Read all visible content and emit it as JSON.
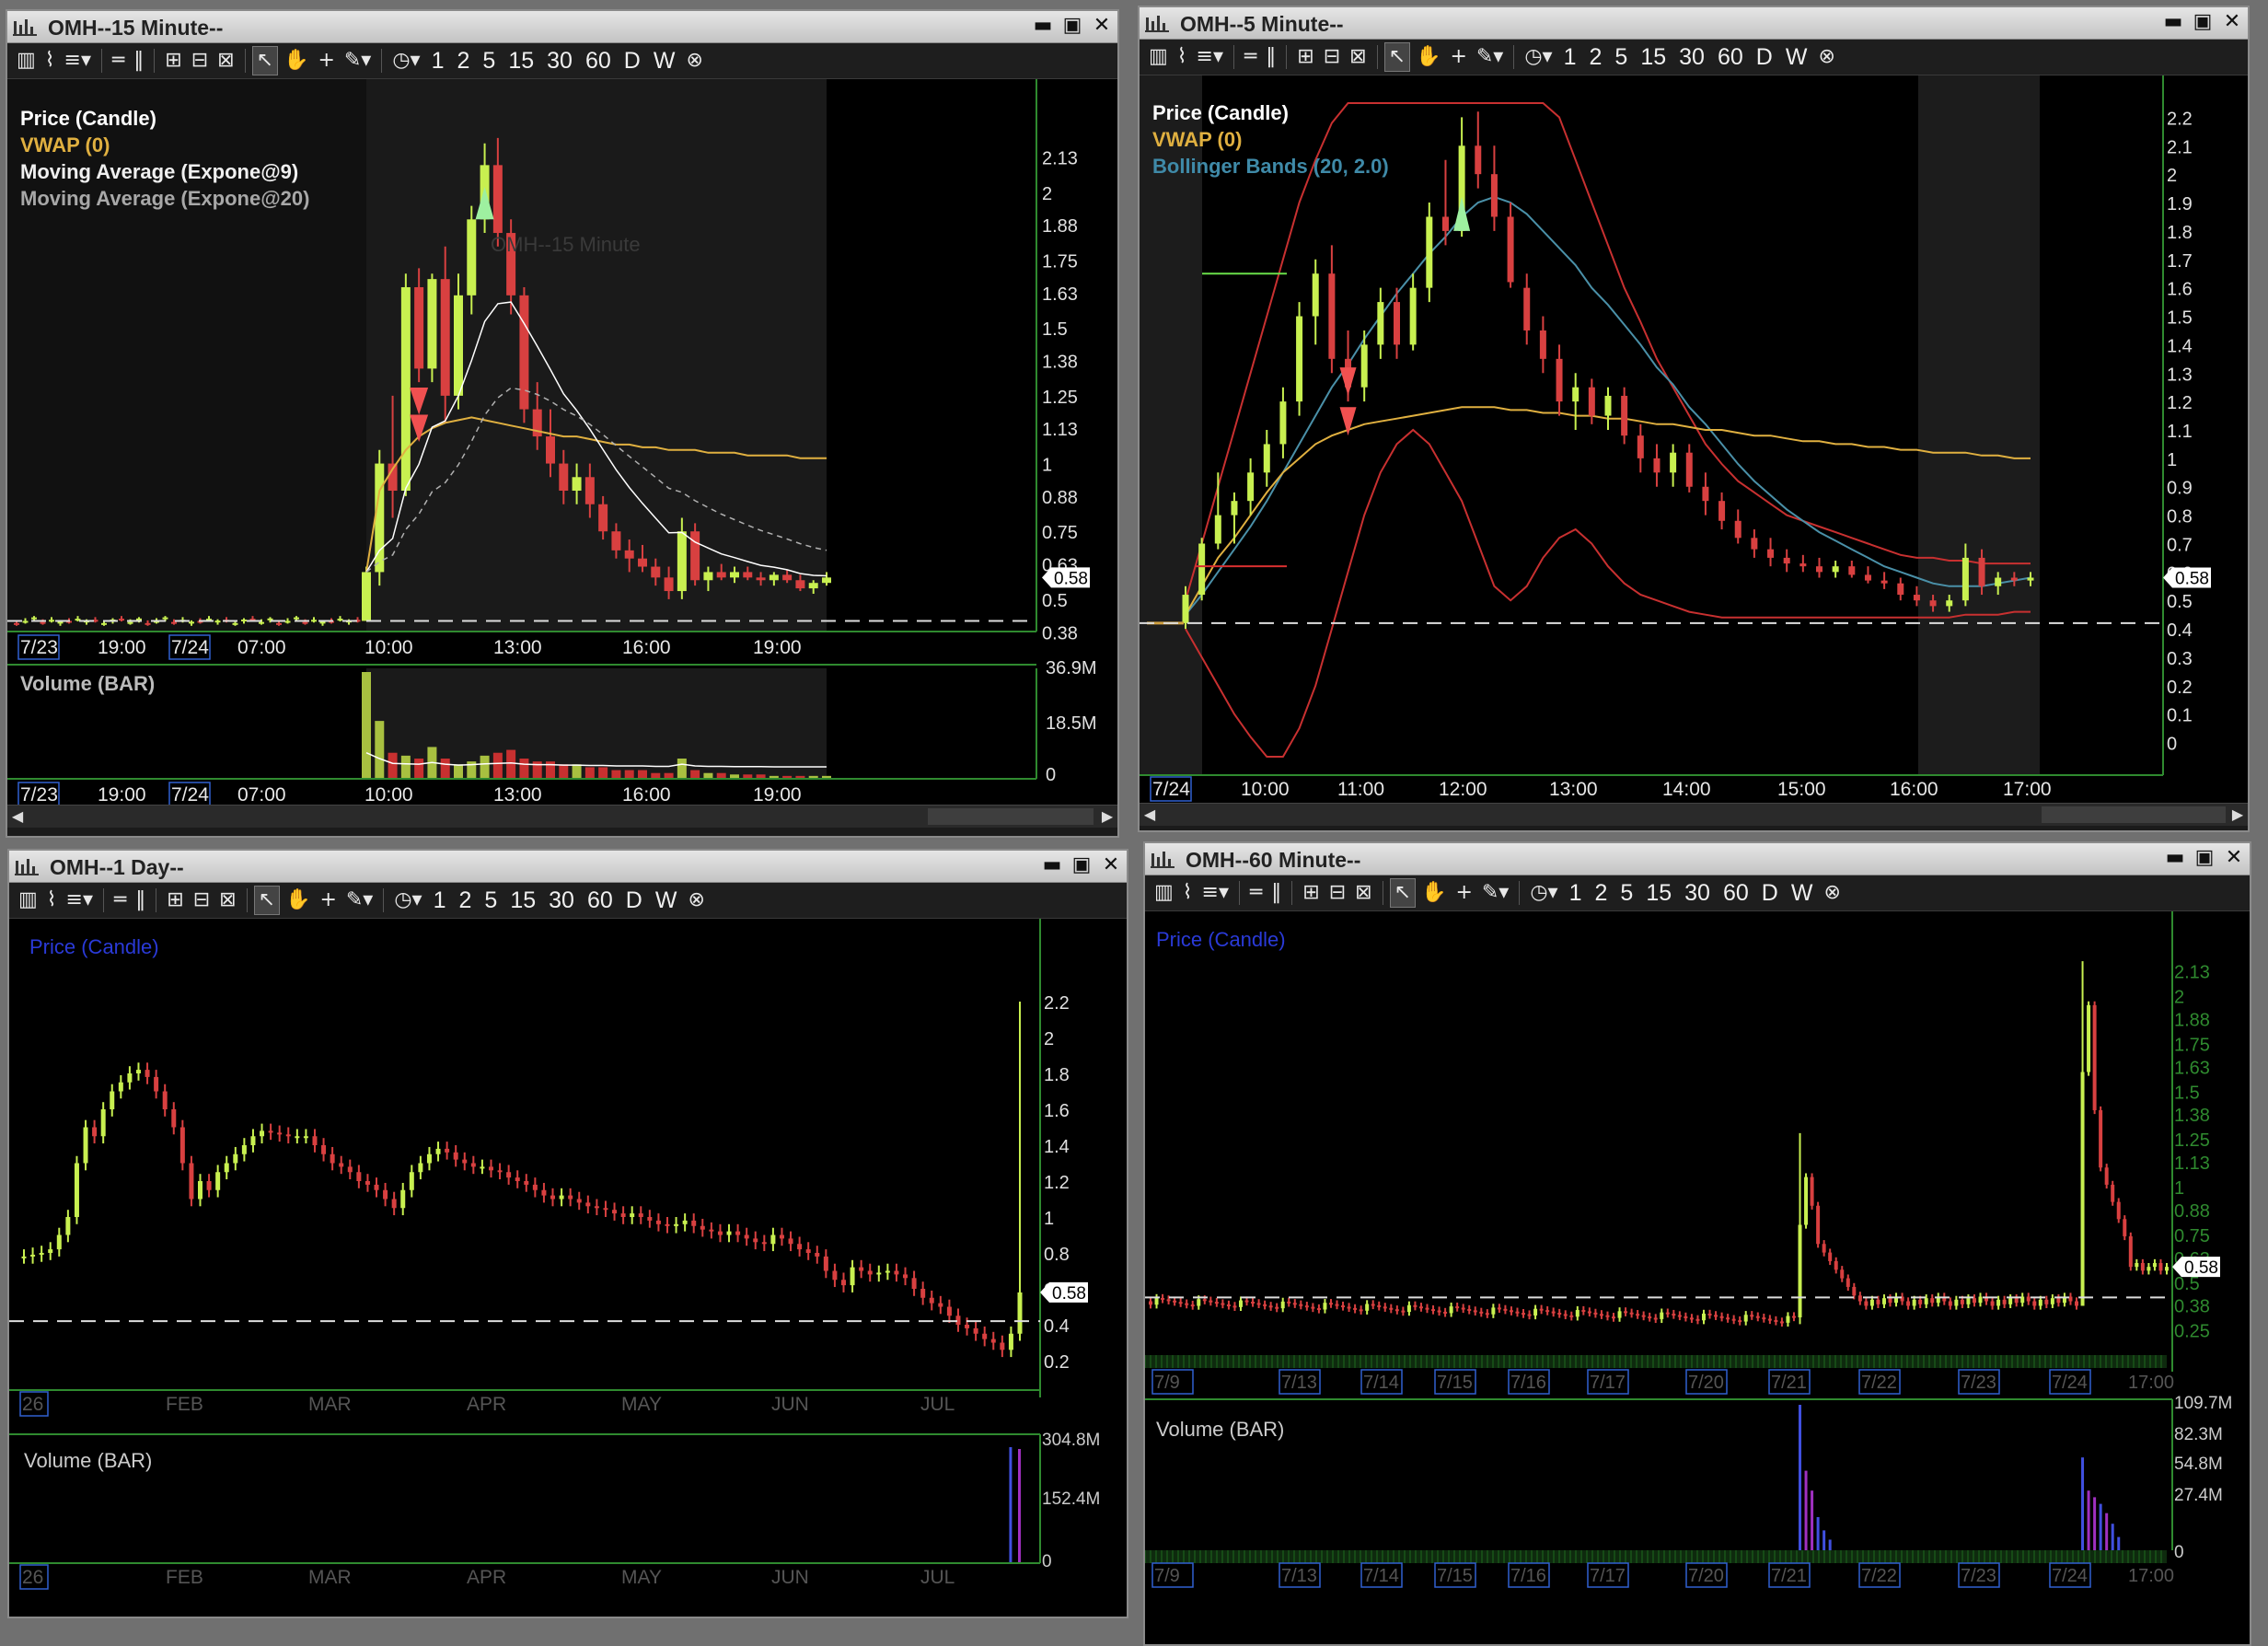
{
  "windows": {
    "w15": {
      "title": "OMH--15 Minute--"
    },
    "w5": {
      "title": "OMH--5 Minute--"
    },
    "wd": {
      "title": "OMH--1 Day--"
    },
    "w60": {
      "title": "OMH--60 Minute--"
    }
  },
  "toolbar": {
    "intervals": [
      "1",
      "2",
      "5",
      "15",
      "30",
      "60",
      "D",
      "W"
    ],
    "icons": [
      "bar-chart-icon",
      "line-style-icon",
      "studies-icon",
      "equal-icon",
      "pause-icon",
      "zoom-in-icon",
      "zoom-out-icon",
      "zoom-fit-icon",
      "pointer-icon",
      "hand-icon",
      "crosshair-icon",
      "pencil-icon",
      "clock-icon",
      "cancel-icon"
    ]
  },
  "colors": {
    "up": "#c8f050",
    "down": "#d84040",
    "vwap": "#e0b040",
    "ema9": "#ffffff",
    "ema20": "#b0b0b0",
    "bb": "#c83030",
    "bbmid": "#4a90a8",
    "axis": "#2f8a2f"
  },
  "chart_data": [
    {
      "type": "candlestick",
      "window": "OMH--15 Minute--",
      "watermark": "OMH--15 Minute",
      "legend": [
        "Price (Candle)",
        "VWAP (0)",
        "Moving Average (Expone@9)",
        "Moving Average (Expone@20)"
      ],
      "y_ticks": [
        "2.13",
        "2",
        "1.88",
        "1.75",
        "1.63",
        "1.5",
        "1.38",
        "1.25",
        "1.13",
        "1",
        "0.88",
        "0.75",
        "0.63",
        "0.5",
        "0.38"
      ],
      "ylim": [
        0.33,
        2.22
      ],
      "x_labels": [
        "7/23",
        "19:00",
        "7/24",
        "07:00",
        "10:00",
        "13:00",
        "16:00",
        "19:00"
      ],
      "last_price": "0.58",
      "reference_line": 0.42,
      "candles_premarket": 40,
      "candles": [
        [
          0.42,
          0.62,
          0.42,
          0.6
        ],
        [
          0.6,
          1.05,
          0.55,
          1.0
        ],
        [
          1.0,
          1.25,
          0.8,
          0.9
        ],
        [
          0.9,
          1.7,
          0.88,
          1.65
        ],
        [
          1.65,
          1.72,
          1.3,
          1.35
        ],
        [
          1.35,
          1.7,
          1.3,
          1.68
        ],
        [
          1.68,
          1.8,
          1.15,
          1.25
        ],
        [
          1.25,
          1.7,
          1.2,
          1.62
        ],
        [
          1.62,
          1.95,
          1.55,
          1.9
        ],
        [
          1.9,
          2.18,
          1.85,
          2.1
        ],
        [
          2.1,
          2.2,
          1.8,
          1.85
        ],
        [
          1.85,
          1.9,
          1.55,
          1.62
        ],
        [
          1.62,
          1.65,
          1.15,
          1.2
        ],
        [
          1.2,
          1.3,
          1.05,
          1.1
        ],
        [
          1.1,
          1.2,
          0.95,
          1.0
        ],
        [
          1.0,
          1.05,
          0.85,
          0.9
        ],
        [
          0.9,
          1.0,
          0.85,
          0.95
        ],
        [
          0.95,
          1.0,
          0.8,
          0.85
        ],
        [
          0.85,
          0.88,
          0.72,
          0.75
        ],
        [
          0.75,
          0.78,
          0.65,
          0.68
        ],
        [
          0.68,
          0.72,
          0.6,
          0.65
        ],
        [
          0.65,
          0.7,
          0.6,
          0.62
        ],
        [
          0.62,
          0.65,
          0.55,
          0.58
        ],
        [
          0.58,
          0.62,
          0.5,
          0.53
        ],
        [
          0.53,
          0.8,
          0.5,
          0.75
        ],
        [
          0.75,
          0.78,
          0.55,
          0.57
        ],
        [
          0.57,
          0.62,
          0.53,
          0.6
        ],
        [
          0.6,
          0.63,
          0.57,
          0.58
        ],
        [
          0.58,
          0.62,
          0.56,
          0.6
        ],
        [
          0.6,
          0.62,
          0.57,
          0.58
        ],
        [
          0.58,
          0.6,
          0.55,
          0.57
        ],
        [
          0.57,
          0.6,
          0.55,
          0.59
        ],
        [
          0.59,
          0.61,
          0.56,
          0.57
        ],
        [
          0.57,
          0.59,
          0.53,
          0.54
        ],
        [
          0.54,
          0.57,
          0.52,
          0.56
        ],
        [
          0.56,
          0.6,
          0.55,
          0.58
        ]
      ],
      "vwap": [
        0.6,
        0.9,
        0.98,
        1.05,
        1.1,
        1.13,
        1.15,
        1.16,
        1.17,
        1.16,
        1.15,
        1.14,
        1.13,
        1.12,
        1.11,
        1.1,
        1.1,
        1.09,
        1.08,
        1.07,
        1.07,
        1.06,
        1.06,
        1.05,
        1.05,
        1.05,
        1.04,
        1.04,
        1.04,
        1.03,
        1.03,
        1.03,
        1.03,
        1.02,
        1.02,
        1.02
      ],
      "volume": {
        "label": "Volume (BAR)",
        "y_ticks": [
          "36.9M",
          "18.5M",
          "0"
        ],
        "max": 36.9,
        "values": [
          36.9,
          20,
          9,
          8,
          7,
          11,
          7,
          5,
          6,
          8,
          9,
          10,
          7,
          6,
          6,
          5,
          5,
          4,
          4,
          3,
          3,
          3,
          2,
          2,
          7,
          3,
          2,
          2,
          1.5,
          1.5,
          1.5,
          1,
          1,
          1,
          1,
          1
        ]
      }
    },
    {
      "type": "candlestick",
      "window": "OMH--5 Minute--",
      "legend": [
        "Price (Candle)",
        "VWAP (0)",
        "Bollinger Bands (20, 2.0)"
      ],
      "y_ticks": [
        "2.2",
        "2.1",
        "2",
        "1.9",
        "1.8",
        "1.7",
        "1.6",
        "1.5",
        "1.4",
        "1.3",
        "1.2",
        "1.1",
        "1",
        "0.9",
        "0.8",
        "0.7",
        "0.6",
        "0.5",
        "0.4",
        "0.3",
        "0.2",
        "0.1",
        "0"
      ],
      "ylim": [
        -0.05,
        2.25
      ],
      "x_labels": [
        "7/24",
        "10:00",
        "11:00",
        "12:00",
        "13:00",
        "14:00",
        "15:00",
        "16:00",
        "17:00"
      ],
      "last_price": "0.58",
      "reference_line": 0.42,
      "candles": [
        [
          0.42,
          0.55,
          0.4,
          0.52
        ],
        [
          0.52,
          0.72,
          0.5,
          0.7
        ],
        [
          0.7,
          0.95,
          0.68,
          0.8
        ],
        [
          0.8,
          0.88,
          0.7,
          0.85
        ],
        [
          0.85,
          1.0,
          0.8,
          0.95
        ],
        [
          0.95,
          1.1,
          0.9,
          1.05
        ],
        [
          1.05,
          1.25,
          1.0,
          1.2
        ],
        [
          1.2,
          1.55,
          1.15,
          1.5
        ],
        [
          1.5,
          1.7,
          1.4,
          1.65
        ],
        [
          1.65,
          1.75,
          1.3,
          1.35
        ],
        [
          1.35,
          1.45,
          1.2,
          1.25
        ],
        [
          1.25,
          1.45,
          1.2,
          1.4
        ],
        [
          1.4,
          1.6,
          1.35,
          1.55
        ],
        [
          1.55,
          1.6,
          1.35,
          1.4
        ],
        [
          1.4,
          1.65,
          1.38,
          1.6
        ],
        [
          1.6,
          1.9,
          1.55,
          1.85
        ],
        [
          1.85,
          2.05,
          1.75,
          1.8
        ],
        [
          1.8,
          2.2,
          1.78,
          2.1
        ],
        [
          2.1,
          2.22,
          1.95,
          2.0
        ],
        [
          2.0,
          2.1,
          1.8,
          1.85
        ],
        [
          1.85,
          1.9,
          1.6,
          1.62
        ],
        [
          1.6,
          1.65,
          1.4,
          1.45
        ],
        [
          1.45,
          1.5,
          1.3,
          1.35
        ],
        [
          1.35,
          1.4,
          1.15,
          1.2
        ],
        [
          1.2,
          1.3,
          1.1,
          1.25
        ],
        [
          1.25,
          1.28,
          1.12,
          1.15
        ],
        [
          1.15,
          1.25,
          1.1,
          1.22
        ],
        [
          1.22,
          1.25,
          1.05,
          1.08
        ],
        [
          1.08,
          1.12,
          0.95,
          1.0
        ],
        [
          1.0,
          1.05,
          0.9,
          0.95
        ],
        [
          0.95,
          1.05,
          0.9,
          1.02
        ],
        [
          1.02,
          1.05,
          0.88,
          0.9
        ],
        [
          0.9,
          0.95,
          0.8,
          0.85
        ],
        [
          0.85,
          0.88,
          0.75,
          0.78
        ],
        [
          0.78,
          0.82,
          0.7,
          0.72
        ],
        [
          0.72,
          0.75,
          0.65,
          0.68
        ],
        [
          0.68,
          0.72,
          0.62,
          0.65
        ],
        [
          0.65,
          0.68,
          0.6,
          0.63
        ],
        [
          0.63,
          0.66,
          0.6,
          0.62
        ],
        [
          0.62,
          0.65,
          0.58,
          0.6
        ],
        [
          0.6,
          0.64,
          0.58,
          0.62
        ],
        [
          0.62,
          0.64,
          0.58,
          0.59
        ],
        [
          0.59,
          0.62,
          0.56,
          0.57
        ],
        [
          0.57,
          0.6,
          0.54,
          0.56
        ],
        [
          0.56,
          0.58,
          0.5,
          0.52
        ],
        [
          0.52,
          0.55,
          0.48,
          0.5
        ],
        [
          0.5,
          0.52,
          0.46,
          0.48
        ],
        [
          0.48,
          0.52,
          0.46,
          0.5
        ],
        [
          0.5,
          0.7,
          0.48,
          0.65
        ],
        [
          0.65,
          0.68,
          0.52,
          0.55
        ],
        [
          0.55,
          0.6,
          0.52,
          0.58
        ],
        [
          0.58,
          0.6,
          0.55,
          0.57
        ],
        [
          0.57,
          0.6,
          0.55,
          0.58
        ]
      ],
      "vwap": [
        0.45,
        0.55,
        0.65,
        0.72,
        0.8,
        0.88,
        0.95,
        1.0,
        1.05,
        1.08,
        1.1,
        1.12,
        1.13,
        1.14,
        1.15,
        1.16,
        1.17,
        1.18,
        1.18,
        1.18,
        1.17,
        1.17,
        1.16,
        1.16,
        1.15,
        1.15,
        1.14,
        1.14,
        1.13,
        1.12,
        1.12,
        1.11,
        1.1,
        1.1,
        1.09,
        1.08,
        1.08,
        1.07,
        1.06,
        1.06,
        1.05,
        1.05,
        1.04,
        1.04,
        1.03,
        1.03,
        1.02,
        1.02,
        1.02,
        1.01,
        1.01,
        1.0,
        1.0
      ],
      "bb_mid": [
        0.45,
        0.52,
        0.6,
        0.68,
        0.76,
        0.85,
        0.95,
        1.05,
        1.15,
        1.25,
        1.33,
        1.42,
        1.5,
        1.58,
        1.65,
        1.72,
        1.78,
        1.85,
        1.9,
        1.92,
        1.9,
        1.86,
        1.8,
        1.74,
        1.68,
        1.6,
        1.54,
        1.47,
        1.4,
        1.32,
        1.26,
        1.18,
        1.12,
        1.05,
        0.98,
        0.92,
        0.87,
        0.82,
        0.78,
        0.74,
        0.71,
        0.68,
        0.65,
        0.62,
        0.6,
        0.58,
        0.56,
        0.55,
        0.55,
        0.55,
        0.56,
        0.57,
        0.58
      ],
      "bb_upper": [
        0.5,
        0.7,
        0.9,
        1.1,
        1.3,
        1.5,
        1.7,
        1.9,
        2.05,
        2.18,
        2.25,
        2.25,
        2.25,
        2.25,
        2.25,
        2.25,
        2.25,
        2.25,
        2.25,
        2.25,
        2.25,
        2.25,
        2.25,
        2.2,
        2.05,
        1.9,
        1.75,
        1.6,
        1.48,
        1.35,
        1.25,
        1.15,
        1.05,
        0.98,
        0.92,
        0.88,
        0.84,
        0.8,
        0.78,
        0.76,
        0.74,
        0.72,
        0.7,
        0.68,
        0.66,
        0.65,
        0.65,
        0.64,
        0.64,
        0.63,
        0.63,
        0.63,
        0.63
      ],
      "bb_lower": [
        0.4,
        0.3,
        0.2,
        0.1,
        0.02,
        -0.05,
        -0.05,
        0.05,
        0.2,
        0.4,
        0.6,
        0.8,
        0.95,
        1.05,
        1.1,
        1.05,
        0.95,
        0.85,
        0.7,
        0.55,
        0.5,
        0.55,
        0.65,
        0.72,
        0.75,
        0.7,
        0.62,
        0.56,
        0.52,
        0.5,
        0.48,
        0.46,
        0.45,
        0.44,
        0.44,
        0.44,
        0.44,
        0.44,
        0.44,
        0.44,
        0.44,
        0.44,
        0.44,
        0.44,
        0.44,
        0.44,
        0.44,
        0.44,
        0.45,
        0.45,
        0.45,
        0.46,
        0.46
      ]
    },
    {
      "type": "candlestick",
      "window": "OMH--1 Day--",
      "legend": [
        "Price (Candle)"
      ],
      "y_ticks": [
        "2.2",
        "2",
        "1.8",
        "1.6",
        "1.4",
        "1.2",
        "1",
        "0.8",
        "0.6",
        "0.4",
        "0.2"
      ],
      "ylim": [
        0.2,
        2.2
      ],
      "x_labels": [
        "26",
        "FEB",
        "MAR",
        "APR",
        "MAY",
        "JUN",
        "JUL"
      ],
      "last_price": "0.58",
      "reference_line": 0.42,
      "closes": [
        0.78,
        0.79,
        0.8,
        0.82,
        0.9,
        1.0,
        1.3,
        1.5,
        1.45,
        1.6,
        1.7,
        1.75,
        1.8,
        1.82,
        1.78,
        1.7,
        1.6,
        1.5,
        1.3,
        1.1,
        1.2,
        1.15,
        1.25,
        1.3,
        1.35,
        1.4,
        1.45,
        1.48,
        1.47,
        1.46,
        1.45,
        1.45,
        1.45,
        1.4,
        1.35,
        1.3,
        1.28,
        1.25,
        1.2,
        1.18,
        1.15,
        1.1,
        1.05,
        1.15,
        1.25,
        1.3,
        1.35,
        1.38,
        1.36,
        1.32,
        1.3,
        1.28,
        1.28,
        1.26,
        1.25,
        1.22,
        1.2,
        1.18,
        1.15,
        1.12,
        1.1,
        1.12,
        1.1,
        1.08,
        1.06,
        1.05,
        1.04,
        1.02,
        1.0,
        1.02,
        1.0,
        0.98,
        0.96,
        0.95,
        0.96,
        0.98,
        0.95,
        0.93,
        0.92,
        0.9,
        0.92,
        0.9,
        0.88,
        0.86,
        0.85,
        0.9,
        0.88,
        0.85,
        0.82,
        0.8,
        0.78,
        0.7,
        0.65,
        0.62,
        0.72,
        0.7,
        0.68,
        0.69,
        0.7,
        0.68,
        0.66,
        0.6,
        0.55,
        0.52,
        0.5,
        0.45,
        0.4,
        0.38,
        0.35,
        0.32,
        0.3,
        0.26,
        0.35,
        0.58
      ],
      "spike_high": 2.2,
      "volume": {
        "label": "Volume (BAR)",
        "y_ticks": [
          "304.8M",
          "152.4M",
          "0"
        ],
        "max": 304.8,
        "last_values": [
          304.8,
          300.0
        ]
      }
    },
    {
      "type": "candlestick",
      "window": "OMH--60 Minute--",
      "legend": [
        "Price (Candle)"
      ],
      "y_ticks": [
        "2.13",
        "2",
        "1.88",
        "1.75",
        "1.63",
        "1.5",
        "1.38",
        "1.25",
        "1.13",
        "1",
        "0.88",
        "0.75",
        "0.63",
        "0.5",
        "0.38",
        "0.25"
      ],
      "ylim": [
        0.2,
        2.2
      ],
      "x_labels": [
        "7/9",
        "7/13",
        "7/14",
        "7/15",
        "7/16",
        "7/17",
        "7/20",
        "7/21",
        "7/22",
        "7/23",
        "7/24",
        "17:00"
      ],
      "last_price": "0.58",
      "reference_line": 0.42,
      "spikes": [
        {
          "at": "7/21",
          "high": 1.28,
          "low": 0.28
        },
        {
          "at": "7/24",
          "high": 2.18,
          "low": 0.4
        }
      ],
      "volume": {
        "label": "Volume (BAR)",
        "y_ticks": [
          "109.7M",
          "82.3M",
          "54.8M",
          "27.4M",
          "0"
        ],
        "max": 109.7
      }
    }
  ]
}
